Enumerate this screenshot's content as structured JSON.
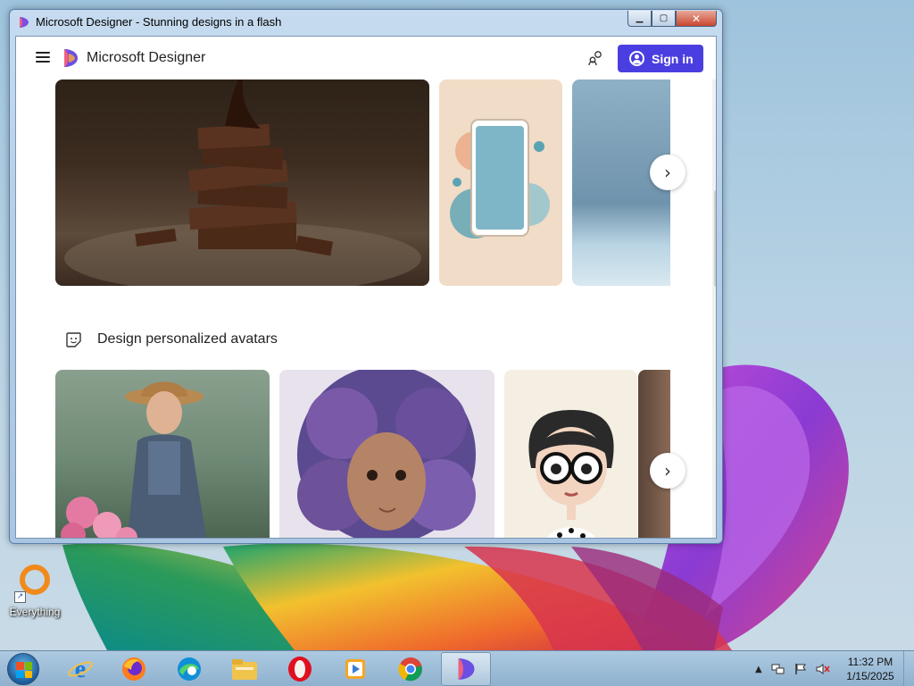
{
  "window": {
    "title": "Microsoft Designer - Stunning designs in a flash",
    "controls": {
      "minimize": "▁",
      "maximize": "▢",
      "close": "✕"
    }
  },
  "app": {
    "brand": "Microsoft Designer",
    "signin_label": "Sign in",
    "icons": [
      "hamburger-menu-icon",
      "designer-logo-icon",
      "people-chat-icon",
      "person-circle-icon"
    ]
  },
  "sections": [
    {
      "title": "",
      "cards": [
        "chocolate-stack-image",
        "phone-illustration-image",
        "blue-gradient-image"
      ]
    },
    {
      "title": "Design personalized avatars",
      "icon": "sticker-icon",
      "cards": [
        "gardener-woman-avatar",
        "curly-hair-girl-avatar",
        "glasses-cartoon-avatar",
        "partial-avatar"
      ]
    }
  ],
  "carousel": {
    "next_glyph": "›"
  },
  "scrollbar": {
    "up_glyph": "▲",
    "down_glyph": "▼"
  },
  "desktop": {
    "icon_label": "Everything",
    "shortcut_glyph": "↗"
  },
  "taskbar": {
    "apps": [
      "internet-explorer-icon",
      "firefox-icon",
      "edge-icon",
      "file-explorer-icon",
      "opera-icon",
      "media-player-icon",
      "chrome-icon",
      "designer-taskbar-icon"
    ],
    "tray": {
      "arrow": "▲"
    },
    "time": "11:32 PM",
    "date": "1/15/2025"
  },
  "colors": {
    "signin_bg": "#4b3ee0",
    "titlebar": "#b6cfe7",
    "taskbar": "#8cafcd"
  }
}
